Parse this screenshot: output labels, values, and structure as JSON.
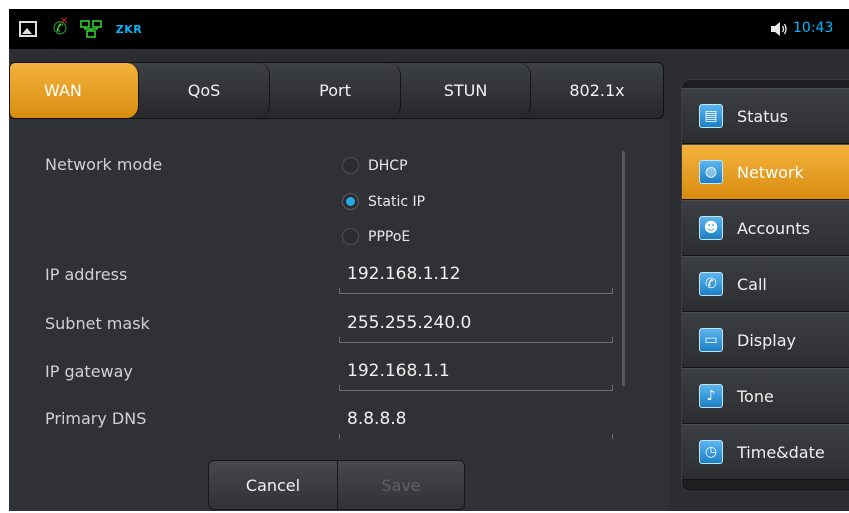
{
  "status_bar": {
    "icons": [
      "gallery-icon",
      "missed-call-icon",
      "network-icon",
      "speaker-icon"
    ],
    "brand": "ZKR",
    "time": "10:43"
  },
  "tabs": [
    {
      "label": "WAN",
      "active": true
    },
    {
      "label": "QoS",
      "active": false
    },
    {
      "label": "Port",
      "active": false
    },
    {
      "label": "STUN",
      "active": false
    },
    {
      "label": "802.1x",
      "active": false
    }
  ],
  "form": {
    "network_mode_label": "Network mode",
    "modes": [
      {
        "label": "DHCP",
        "checked": false
      },
      {
        "label": "Static IP",
        "checked": true
      },
      {
        "label": "PPPoE",
        "checked": false
      }
    ],
    "ip_address_label": "IP address",
    "ip_address_value": "192.168.1.12",
    "subnet_mask_label": "Subnet mask",
    "subnet_mask_value": "255.255.240.0",
    "ip_gateway_label": "IP gateway",
    "ip_gateway_value": "192.168.1.1",
    "primary_dns_label": "Primary DNS",
    "primary_dns_value": "8.8.8.8"
  },
  "buttons": {
    "cancel": "Cancel",
    "save": "Save"
  },
  "menu": [
    {
      "label": "Status",
      "icon": "status-icon",
      "active": false
    },
    {
      "label": "Network",
      "icon": "network-globe-icon",
      "active": true
    },
    {
      "label": "Accounts",
      "icon": "accounts-icon",
      "active": false
    },
    {
      "label": "Call",
      "icon": "call-icon",
      "active": false
    },
    {
      "label": "Display",
      "icon": "display-icon",
      "active": false
    },
    {
      "label": "Tone",
      "icon": "tone-icon",
      "active": false
    },
    {
      "label": "Time&date",
      "icon": "clock-icon",
      "active": false
    }
  ],
  "colors": {
    "accent": "#f0a830",
    "radio_selected": "#29a9ea",
    "time_text": "#00b7ff"
  }
}
